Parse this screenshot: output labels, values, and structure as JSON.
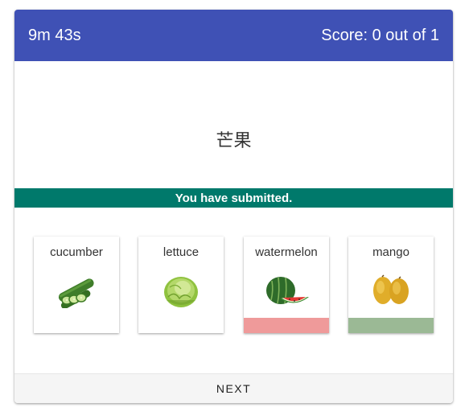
{
  "header": {
    "timer": "9m 43s",
    "score": "Score: 0 out of 1"
  },
  "prompt": {
    "text": "芒果"
  },
  "status": {
    "text": "You have submitted.",
    "color": "#00796b"
  },
  "options": [
    {
      "label": "cucumber",
      "icon": "cucumber-icon",
      "result": "none"
    },
    {
      "label": "lettuce",
      "icon": "lettuce-icon",
      "result": "none"
    },
    {
      "label": "watermelon",
      "icon": "watermelon-icon",
      "result": "incorrect"
    },
    {
      "label": "mango",
      "icon": "mango-icon",
      "result": "correct"
    }
  ],
  "colors": {
    "header": "#3f51b5",
    "incorrect": "#ef9a9a",
    "correct": "#9bb995"
  },
  "footer": {
    "next_label": "NEXT"
  }
}
